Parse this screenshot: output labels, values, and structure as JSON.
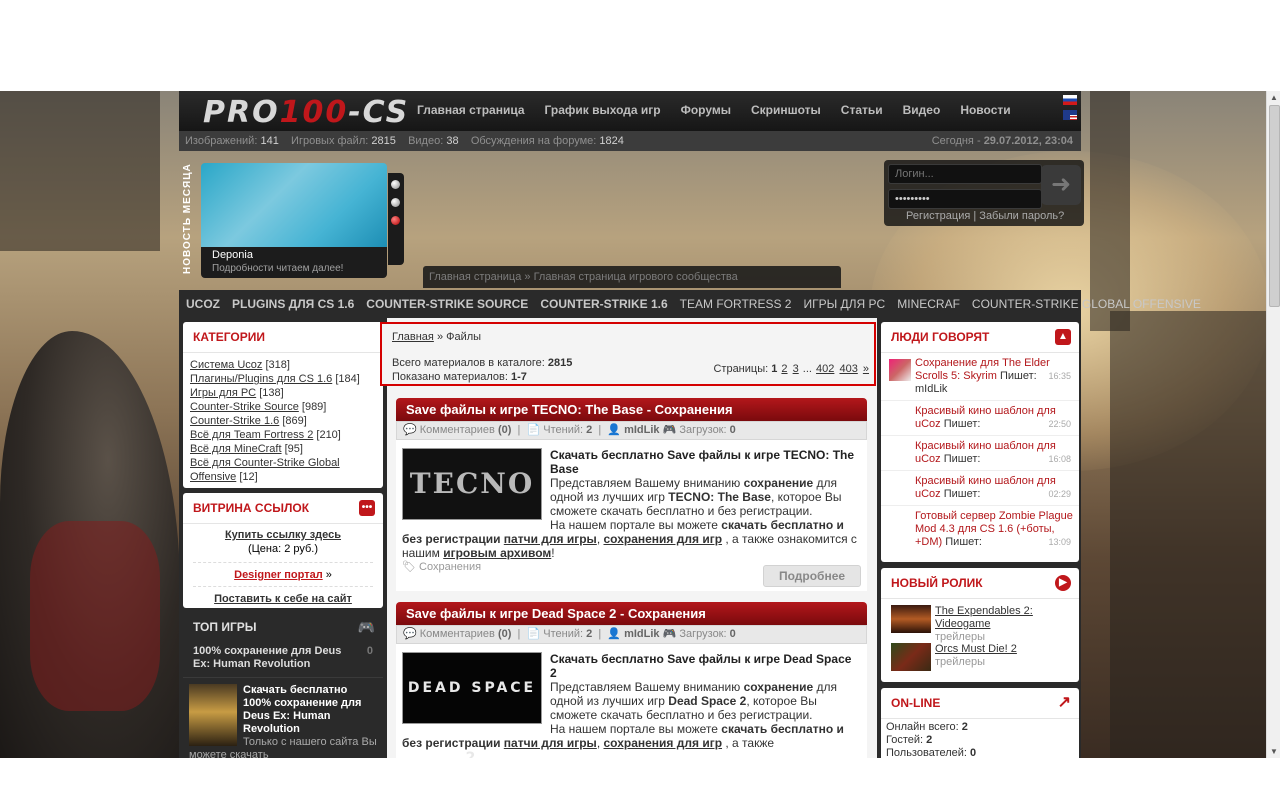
{
  "site": {
    "logo_a": "PRO",
    "logo_b": "100",
    "logo_c": "-CS"
  },
  "nav": [
    "Главная страница",
    "График выхода игр",
    "Форумы",
    "Скриншоты",
    "Статьи",
    "Видео",
    "Новости"
  ],
  "stats": {
    "images_label": "Изображений:",
    "images": "141",
    "files_label": "Игровых файл:",
    "files": "2815",
    "video_label": "Видео:",
    "video": "38",
    "forum_label": "Обсуждения на форуме:",
    "forum": "1824",
    "today_label": "Сегодня -",
    "today": "29.07.2012, 23:04"
  },
  "news_month": {
    "vertical": "НОВОСТЬ МЕСЯЦА",
    "title": "Deponia",
    "subtitle": "Подробности читаем далее!"
  },
  "login": {
    "login_placeholder": "Логин...",
    "password_value": "•••••••••",
    "register": "Регистрация",
    "sep": "|",
    "forgot": "Забыли пароль?"
  },
  "top_crumb": {
    "a": "Главная страница",
    "sep": "»",
    "b": "Главная страница игрового сообщества"
  },
  "catbar": [
    {
      "label": "UCOZ",
      "bold": true
    },
    {
      "label": "PLUGINS ДЛЯ CS 1.6",
      "bold": true
    },
    {
      "label": "COUNTER-STRIKE SOURCE",
      "bold": true
    },
    {
      "label": "COUNTER-STRIKE 1.6",
      "bold": true
    },
    {
      "label": "TEAM FORTRESS 2",
      "bold": false
    },
    {
      "label": "ИГРЫ ДЛЯ PC",
      "bold": false
    },
    {
      "label": "MINECRAF",
      "bold": false
    },
    {
      "label": "COUNTER-STRIKE GLOBAL OFFENSIVE",
      "bold": false
    }
  ],
  "categories": {
    "title": "КАТЕГОРИИ",
    "items": [
      {
        "name": "Система Ucoz",
        "count": "[318]"
      },
      {
        "name": "Плагины/Plugins для CS 1.6",
        "count": "[184]"
      },
      {
        "name": "Игры для PC",
        "count": "[138]"
      },
      {
        "name": "Counter-Strike Source",
        "count": "[989]"
      },
      {
        "name": "Counter-Strike 1.6",
        "count": "[869]"
      },
      {
        "name": "Всё для Team Fortress 2",
        "count": "[210]"
      },
      {
        "name": "Всё для MineCraft",
        "count": "[95]"
      },
      {
        "name": "Всё для Counter-Strike Global",
        "count": ""
      },
      {
        "name": "Offensive",
        "count": "[12]"
      }
    ]
  },
  "links_showcase": {
    "title": "ВИТРИНА ССЫЛОК",
    "buy": "Купить ссылку здесь",
    "price": "(Цена: 2 руб.)",
    "designer": "Designer портал",
    "designer_arrow": "»",
    "put": "Поставить к себе на сайт"
  },
  "top_games": {
    "title": "ТОП ИГРЫ",
    "first": "100% сохранение для Deus Ex: Human Revolution",
    "first_count": "0",
    "second_title": "Скачать бесплатно 100% сохранение для Deus Ex: Human Revolution",
    "second_text": "Только с нашего сайта Вы можете скачать"
  },
  "catalog": {
    "crumb_home": "Главная",
    "crumb_sep": "»",
    "crumb_cur": "Файлы",
    "total_label": "Всего материалов в каталоге:",
    "total": "2815",
    "shown_label": "Показано материалов:",
    "shown": "1-7",
    "pages_label": "Страницы:",
    "pages": [
      "1",
      "2",
      "3",
      "...",
      "402",
      "403",
      "»"
    ]
  },
  "entries": [
    {
      "title": "Save файлы к игре TECNO: The Base - Сохранения",
      "comments_label": "Комментариев",
      "comments": "(0)",
      "reads_label": "Чтений:",
      "reads": "2",
      "author": "mIdLik",
      "downloads_label": "Загрузок:",
      "downloads": "0",
      "heading": "Скачать бесплатно Save файлы к игре TECNO: The Base",
      "p1a": "Представляем Вашему вниманию ",
      "p1b": "сохранение",
      "p1c": " для одной из лучших игр ",
      "p1d": "TECNO: The Base",
      "p1e": ", которое Вы сможете скачать бесплатно и без регистрации.",
      "p2a": "На нашем портале вы можете ",
      "p2b": "скачать бесплатно и без регистрации",
      "p2c": "патчи для игры",
      "p2d": "сохранения для игр",
      "p2e": ", а также ознакомится с нашим ",
      "p2f": "игровым архивом",
      "p2g": "!",
      "tag": "Сохранения",
      "more": "Подробнее",
      "thumb_text": "TECNO"
    },
    {
      "title": "Save файлы к игре Dead Space 2 - Сохранения",
      "comments_label": "Комментариев",
      "comments": "(0)",
      "reads_label": "Чтений:",
      "reads": "2",
      "author": "mIdLik",
      "downloads_label": "Загрузок:",
      "downloads": "0",
      "heading": "Скачать бесплатно Save файлы к игре Dead Space 2",
      "p1a": "Представляем Вашему вниманию ",
      "p1b": "сохранение",
      "p1c": " для одной из лучших игр ",
      "p1d": "Dead Space 2",
      "p1e": ", которое Вы сможете скачать бесплатно и без регистрации.",
      "p2a": "На нашем портале вы можете ",
      "p2b": "скачать бесплатно и без регистрации",
      "p2c": "патчи для игры",
      "p2d": "сохранения для игр",
      "p2e": ", а также",
      "p2f": "",
      "p2g": "",
      "tag": "",
      "more": "",
      "thumb_text": "DEAD SPACE 2"
    }
  ],
  "people": {
    "title": "ЛЮДИ ГОВОРЯТ",
    "items": [
      {
        "title": "Сохранение для The Elder Scrolls 5: Skyrim",
        "wrote": "Пишет:",
        "author": "mIdLik",
        "time": "16:35"
      },
      {
        "title": "Красивый кино шаблон для uCoz",
        "wrote": "Пишет:",
        "author": "",
        "time": "22:50"
      },
      {
        "title": "Красивый кино шаблон для uCoz",
        "wrote": "Пишет:",
        "author": "",
        "time": "16:08"
      },
      {
        "title": "Красивый кино шаблон для uCoz",
        "wrote": "Пишет:",
        "author": "",
        "time": "02:29"
      },
      {
        "title": "Готовый сервер Zombie Plague Mod 4.3 для CS 1.6 (+боты, +DM)",
        "wrote": "Пишет:",
        "author": "",
        "time": "13:09"
      }
    ]
  },
  "new_video": {
    "title": "НОВЫЙ РОЛИК",
    "items": [
      {
        "name": "The Expendables 2: Videogame",
        "cat": "трейлеры"
      },
      {
        "name": "Orcs Must Die! 2",
        "cat": "трейлеры"
      }
    ]
  },
  "online": {
    "title": "ON-LINE",
    "total_label": "Онлайн всего:",
    "total": "2",
    "guests_label": "Гостей:",
    "guests": "2",
    "users_label": "Пользователей:",
    "users": "0"
  },
  "colors": {
    "accent": "#c0171b",
    "dark": "#2a2a2a",
    "highlight": "#d40000"
  }
}
